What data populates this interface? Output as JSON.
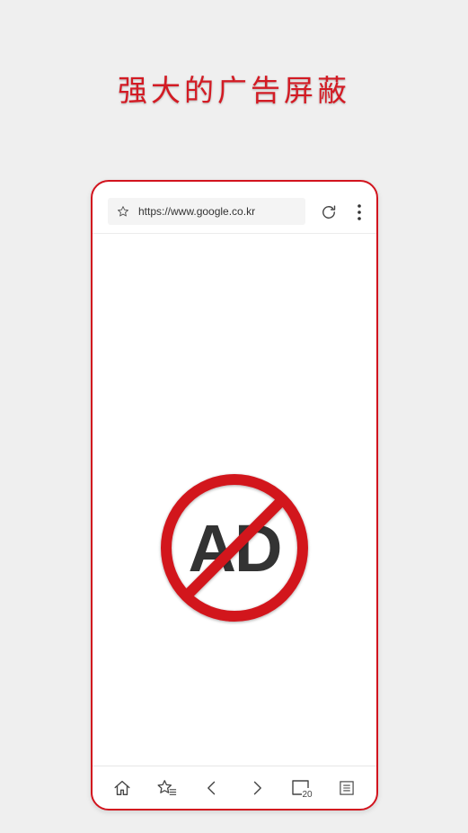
{
  "headline": "强大的广告屏蔽",
  "browser": {
    "url": "https://www.google.co.kr",
    "tab_count": "20"
  },
  "colors": {
    "accent": "#d2141e",
    "background": "#efefef",
    "ad_text": "#333333"
  },
  "icons": {
    "bookmark": "star-icon",
    "reload": "reload-icon",
    "menu": "more-vertical-icon",
    "home": "home-icon",
    "bookmarks": "bookmarks-icon",
    "back": "chevron-left-icon",
    "forward": "chevron-right-icon",
    "tabs": "tabs-icon",
    "list": "menu-list-icon"
  },
  "center_graphic": {
    "text": "AD"
  }
}
